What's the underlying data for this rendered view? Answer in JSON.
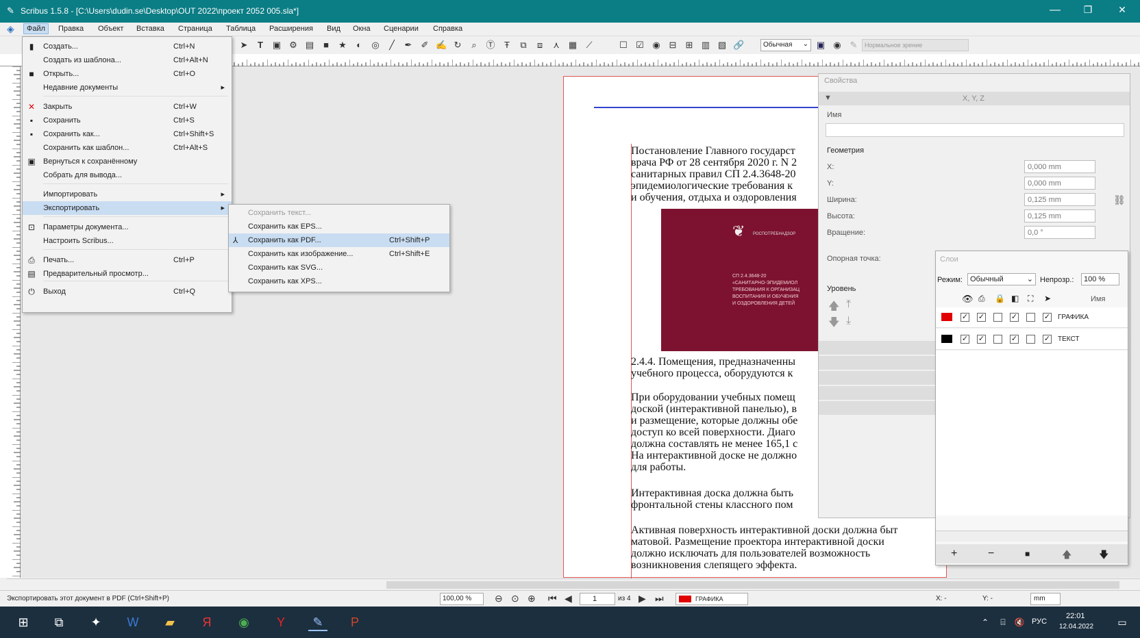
{
  "window": {
    "title": "Scribus 1.5.8 - [C:\\Users\\dudin.se\\Desktop\\OUT 2022\\проект 2052 005.sla*]",
    "min": "—",
    "max": "❐",
    "close": "✕"
  },
  "menubar": [
    "Файл",
    "Правка",
    "Объект",
    "Вставка",
    "Страница",
    "Таблица",
    "Расширения",
    "Вид",
    "Окна",
    "Сценарии",
    "Справка"
  ],
  "file_menu": [
    {
      "label": "Создать...",
      "shortcut": "Ctrl+N",
      "icon": "new-doc-icon"
    },
    {
      "label": "Создать из шаблона...",
      "shortcut": "Ctrl+Alt+N",
      "icon": ""
    },
    {
      "label": "Открыть...",
      "shortcut": "Ctrl+O",
      "icon": "folder-icon"
    },
    {
      "label": "Недавние документы",
      "shortcut": "",
      "icon": "",
      "sub": true
    },
    {
      "label": "Закрыть",
      "shortcut": "Ctrl+W",
      "icon": "close-icon"
    },
    {
      "label": "Сохранить",
      "shortcut": "Ctrl+S",
      "icon": "save-icon"
    },
    {
      "label": "Сохранить как...",
      "shortcut": "Ctrl+Shift+S",
      "icon": "save-as-icon"
    },
    {
      "label": "Сохранить как шаблон...",
      "shortcut": "Ctrl+Alt+S",
      "icon": ""
    },
    {
      "label": "Вернуться к сохранённому",
      "shortcut": "",
      "icon": "revert-icon"
    },
    {
      "label": "Собрать для вывода...",
      "shortcut": "",
      "icon": ""
    },
    {
      "label": "Импортировать",
      "shortcut": "",
      "icon": "",
      "sub": true
    },
    {
      "label": "Экспортировать",
      "shortcut": "",
      "icon": "",
      "sub": true,
      "active": true
    },
    {
      "label": "Параметры документа...",
      "shortcut": "",
      "icon": "doc-settings-icon"
    },
    {
      "label": "Настроить Scribus...",
      "shortcut": "",
      "icon": ""
    },
    {
      "label": "Печать...",
      "shortcut": "Ctrl+P",
      "icon": "printer-icon"
    },
    {
      "label": "Предварительный просмотр...",
      "shortcut": "",
      "icon": "preview-icon"
    },
    {
      "label": "Выход",
      "shortcut": "Ctrl+Q",
      "icon": "power-icon"
    }
  ],
  "export_menu": [
    {
      "label": "Сохранить текст...",
      "shortcut": "",
      "disabled": true
    },
    {
      "label": "Сохранить как EPS...",
      "shortcut": ""
    },
    {
      "label": "Сохранить как PDF...",
      "shortcut": "Ctrl+Shift+P",
      "active": true
    },
    {
      "label": "Сохранить как изображение...",
      "shortcut": "Ctrl+Shift+E"
    },
    {
      "label": "Сохранить как SVG...",
      "shortcut": ""
    },
    {
      "label": "Сохранить как XPS...",
      "shortcut": ""
    }
  ],
  "toolbar": {
    "mode_select": "Обычная",
    "style_select": "Нормальное зрение"
  },
  "document": {
    "para1": "Постановление Главного государст\nврача РФ от 28 сентября 2020 г. N 2\nсанитарных правил СП 2.4.3648-20\nэпидемиологические требования к\nи обучения, отдыха и оздоровления",
    "cover_org": "РОСПОТРЕБНАДЗОР",
    "cover_text": "СП 2.4.3648-20\n«САНИТАРНО-ЭПИДЕМИОЛ\nТРЕБОВАНИЯ К ОРГАНИЗАЦ\nВОСПИТАНИЯ И ОБУЧЕНИЯ\nИ ОЗДОРОВЛЕНИЯ ДЕТЕЙ",
    "para2": "2.4.4. Помещения, предназначенны\nучебного процесса, оборудуются к",
    "para3": "При оборудовании учебных помещ\nдоской (интерактивной панелью), в\nи размещение, которые должны обе\nдоступ ко всей поверхности. Диаго\nдолжна составлять не менее 165,1 с\nНа интерактивной доске не должно\nдля работы.",
    "para4": "Интерактивная доска должна быть\nфронтальной стены классного пом",
    "para5": "Активная поверхность интерактивной доски должна быт\nматовой. Размещение проектора интерактивной доски\nдолжно исключать для пользователей возможность\nвозникновения слепящего эффекта."
  },
  "properties": {
    "title": "Свойства",
    "tab": "X, Y, Z",
    "name_label": "Имя",
    "geometry_label": "Геометрия",
    "x_label": "X:",
    "x_val": "0,000 mm",
    "y_label": "Y:",
    "y_val": "0,000 mm",
    "w_label": "Ширина:",
    "w_val": "0,125 mm",
    "h_label": "Высота:",
    "h_val": "0,125 mm",
    "rot_label": "Вращение:",
    "rot_val": "0,0 °",
    "anchor_label": "Опорная точка:",
    "level_label": "Уровень"
  },
  "layers": {
    "title": "Слои",
    "mode_label": "Режим:",
    "mode_val": "Обычный",
    "opacity_label": "Непрозр.:",
    "opacity_val": "100 %",
    "name_col": "Имя",
    "rows": [
      {
        "name": "ГРАФИКА",
        "color": "#e00000"
      },
      {
        "name": "ТЕКСТ",
        "color": "#000000"
      }
    ],
    "add": "+",
    "remove": "−",
    "dup": "■",
    "up": "🡅",
    "down": "🡇"
  },
  "statusbar": {
    "hint": "Экспортировать этот документ в PDF (Ctrl+Shift+P)",
    "zoom": "100,00 %",
    "page": "1",
    "of": "из 4",
    "layer": "ГРАФИКА",
    "x": "X: -",
    "y": "Y: -",
    "unit": "mm"
  },
  "taskbar": {
    "lang": "РУС",
    "time": "22:01",
    "date": "12.04.2022"
  }
}
